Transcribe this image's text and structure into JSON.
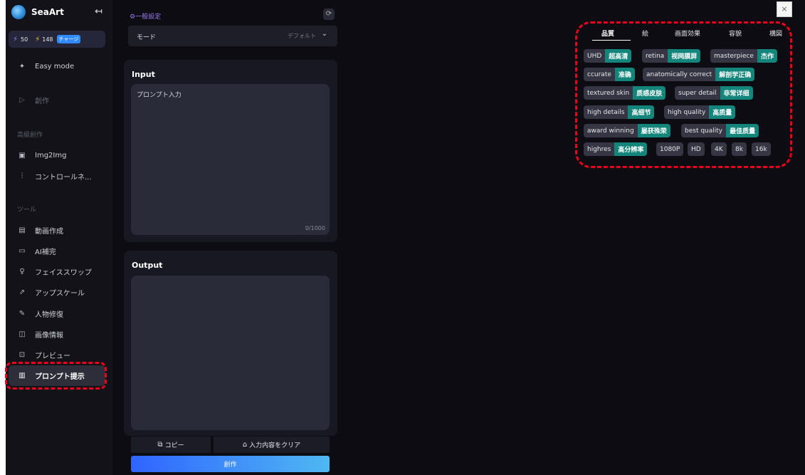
{
  "brand": {
    "name": "SeaArt",
    "collapse_icon": "collapse-left-icon"
  },
  "credits": {
    "stamina": "50",
    "energy": "148",
    "charge_label": "チャージ"
  },
  "sidebar": {
    "items": [
      {
        "label": "Easy mode",
        "icon": "sparkle-icon"
      },
      {
        "label": "創作",
        "icon": "play-icon"
      },
      {
        "label": "Img2Img",
        "icon": "image-icon"
      },
      {
        "label": "コントロールネ...",
        "icon": "sliders-icon"
      },
      {
        "label": "動画作成",
        "icon": "video-icon"
      },
      {
        "label": "AI補完",
        "icon": "ai-complete-icon"
      },
      {
        "label": "フェイススワップ",
        "icon": "face-icon"
      },
      {
        "label": "アップスケール",
        "icon": "upscale-icon"
      },
      {
        "label": "人物修復",
        "icon": "repair-icon"
      },
      {
        "label": "画像情報",
        "icon": "book-icon"
      },
      {
        "label": "プレビュー",
        "icon": "preview-icon"
      },
      {
        "label": "プロンプト提示",
        "icon": "prompt-icon"
      }
    ],
    "sections": {
      "advanced": "高級創作",
      "tools": "ツール"
    }
  },
  "settings": {
    "title": "⚙一般設定",
    "mode_label": "モード",
    "mode_value": "デフォルト"
  },
  "input": {
    "title": "Input",
    "placeholder": "プロンプト入力",
    "counter": "0/1000"
  },
  "output": {
    "title": "Output",
    "copy_label": "コピー",
    "clear_label": "入力内容をクリア",
    "create_label": "創作"
  },
  "prompt_panel": {
    "close": "×",
    "tabs": [
      "品質",
      "絵",
      "画面効果",
      "容貌",
      "構図"
    ],
    "active_tab": "品質",
    "chips": [
      {
        "en": "UHD",
        "zh": "超高清"
      },
      {
        "en": "retina",
        "zh": "视网膜屏"
      },
      {
        "en": "masterpiece",
        "zh": "杰作"
      },
      {
        "en": "ccurate",
        "zh": "准确"
      },
      {
        "en": "anatomically correct",
        "zh": "解剖学正确"
      },
      {
        "en": "textured skin",
        "zh": "质感皮肤"
      },
      {
        "en": "super detail",
        "zh": "非常详细"
      },
      {
        "en": "high details",
        "zh": "高细节"
      },
      {
        "en": "high quality",
        "zh": "高质量"
      },
      {
        "en": "award winning",
        "zh": "屡获殊荣"
      },
      {
        "en": "best quality",
        "zh": "最佳质量"
      },
      {
        "en": "highres",
        "zh": "高分辨率"
      },
      {
        "en": "1080P",
        "zh": ""
      },
      {
        "en": "HD",
        "zh": ""
      },
      {
        "en": "4K",
        "zh": ""
      },
      {
        "en": "8k",
        "zh": ""
      },
      {
        "en": "16k",
        "zh": ""
      }
    ]
  },
  "colors": {
    "accent": "#13857b",
    "highlight": "#e8001c",
    "create_gradient_start": "#2f64ff",
    "create_gradient_end": "#4fb8f2"
  }
}
